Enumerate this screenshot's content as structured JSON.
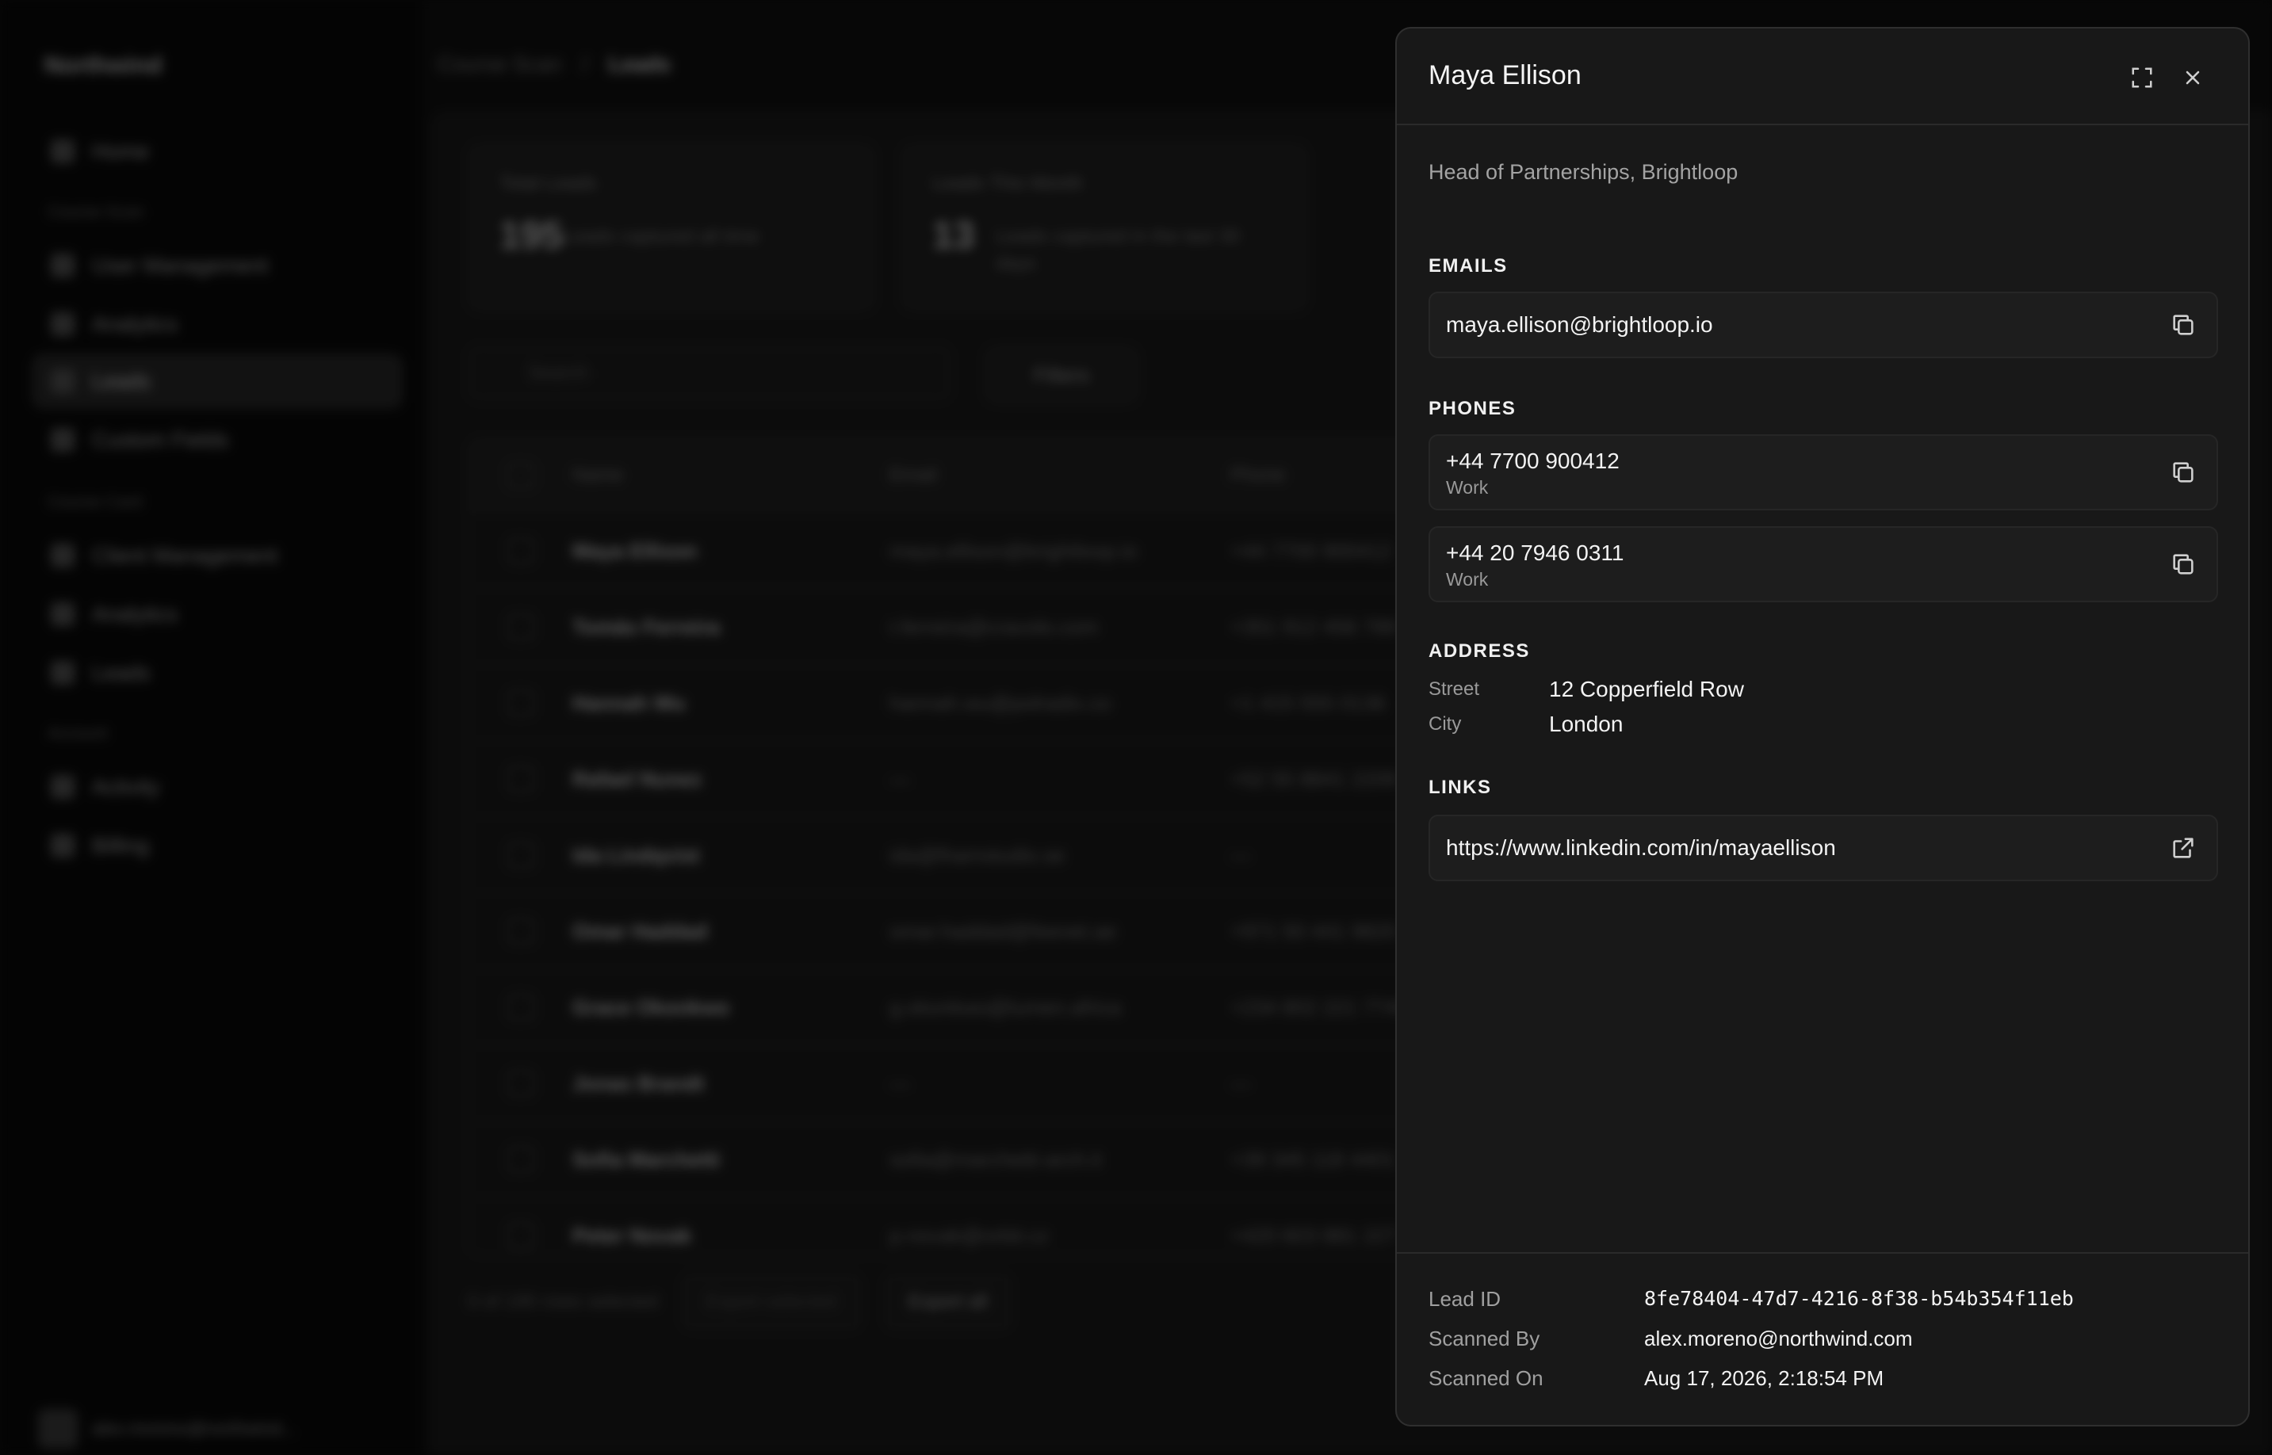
{
  "background": {
    "brand": "Northwind",
    "breadcrumb": [
      "Course Scan",
      "Leads"
    ],
    "nav": {
      "home": "Home",
      "group1": "Course Scan",
      "group1_items": [
        "User Management",
        "Analytics",
        "Leads",
        "Custom Fields"
      ],
      "group2": "Course Card",
      "group2_items": [
        "Client Management",
        "Analytics",
        "Leads"
      ],
      "group3": "Account",
      "group3_items": [
        "Activity",
        "Billing"
      ]
    },
    "user": "alex.moreno@northwind...",
    "stats": [
      {
        "label": "Total Leads",
        "value": "195",
        "sub": "Leads captured all time"
      },
      {
        "label": "Leads This Month",
        "value": "13",
        "sub": "Leads captured in the last 30 days"
      }
    ],
    "search_placeholder": "Search",
    "filters_label": "Filters",
    "columns": [
      "Name",
      "Email",
      "Phone"
    ],
    "rows": [
      {
        "name": "Maya Ellison",
        "email": "maya.ellison@brightloop.io",
        "phone": "+44 7700 900412"
      },
      {
        "name": "Tomás Ferreira",
        "email": "t.ferreira@cravolo.com",
        "phone": "+351 912 456 789"
      },
      {
        "name": "Hannah Wu",
        "email": "hannah.wu@polradix.co",
        "phone": "+1 415 555 0136"
      },
      {
        "name": "Rafael Nunez",
        "email": "—",
        "phone": "+52 55 8841 2209"
      },
      {
        "name": "Ida Lindqvist",
        "email": "ida@lhamstudio.se",
        "phone": "—"
      },
      {
        "name": "Omar Haddad",
        "email": "omar.haddad@feenet.ae",
        "phone": "+971 50 441 9820"
      },
      {
        "name": "Grace Okonkwo",
        "email": "g.okonkwo@lumen.africa",
        "phone": "+234 802 221 7745"
      },
      {
        "name": "Jonas Brandt",
        "email": "—",
        "phone": "—"
      },
      {
        "name": "Sofia Marchetti",
        "email": "sofia@marchetti-arch.it",
        "phone": "+39 345 118 4401"
      },
      {
        "name": "Peter Novak",
        "email": "p.novak@orbit.cz",
        "phone": "+420 603 881 227"
      }
    ],
    "selection_text": "0 of 195 rows selected",
    "export_selected": "Export selected",
    "export_all": "Export all"
  },
  "lead": {
    "name": "Maya Ellison",
    "headline": "Head of Partnerships, Brightloop",
    "emails_title": "EMAILS",
    "email": "maya.ellison@brightloop.io",
    "phones_title": "PHONES",
    "phones": [
      {
        "number": "+44 7700 900412",
        "type": "Work"
      },
      {
        "number": "+44 20 7946 0311",
        "type": "Work"
      }
    ],
    "address_title": "ADDRESS",
    "street_label": "Street",
    "street": "12 Copperfield Row",
    "city_label": "City",
    "city": "London",
    "links_title": "LINKS",
    "link": "https://www.linkedin.com/in/mayaellison",
    "meta": {
      "lead_id_label": "Lead ID",
      "lead_id": "8fe78404-47d7-4216-8f38-b54b354f11eb",
      "scanned_by_label": "Scanned By",
      "scanned_by": "alex.moreno@northwind.com",
      "scanned_on_label": "Scanned On",
      "scanned_on": "Aug 17, 2026, 2:18:54 PM"
    }
  },
  "icons": {
    "expand": "expand-icon",
    "close": "close-icon",
    "copy": "copy-icon",
    "external": "external-link-icon"
  },
  "colors": {
    "panel_bg": "#181818",
    "card_bg": "#1d1d1d",
    "text": "#f3f3f3",
    "muted": "#a0a0a0"
  }
}
